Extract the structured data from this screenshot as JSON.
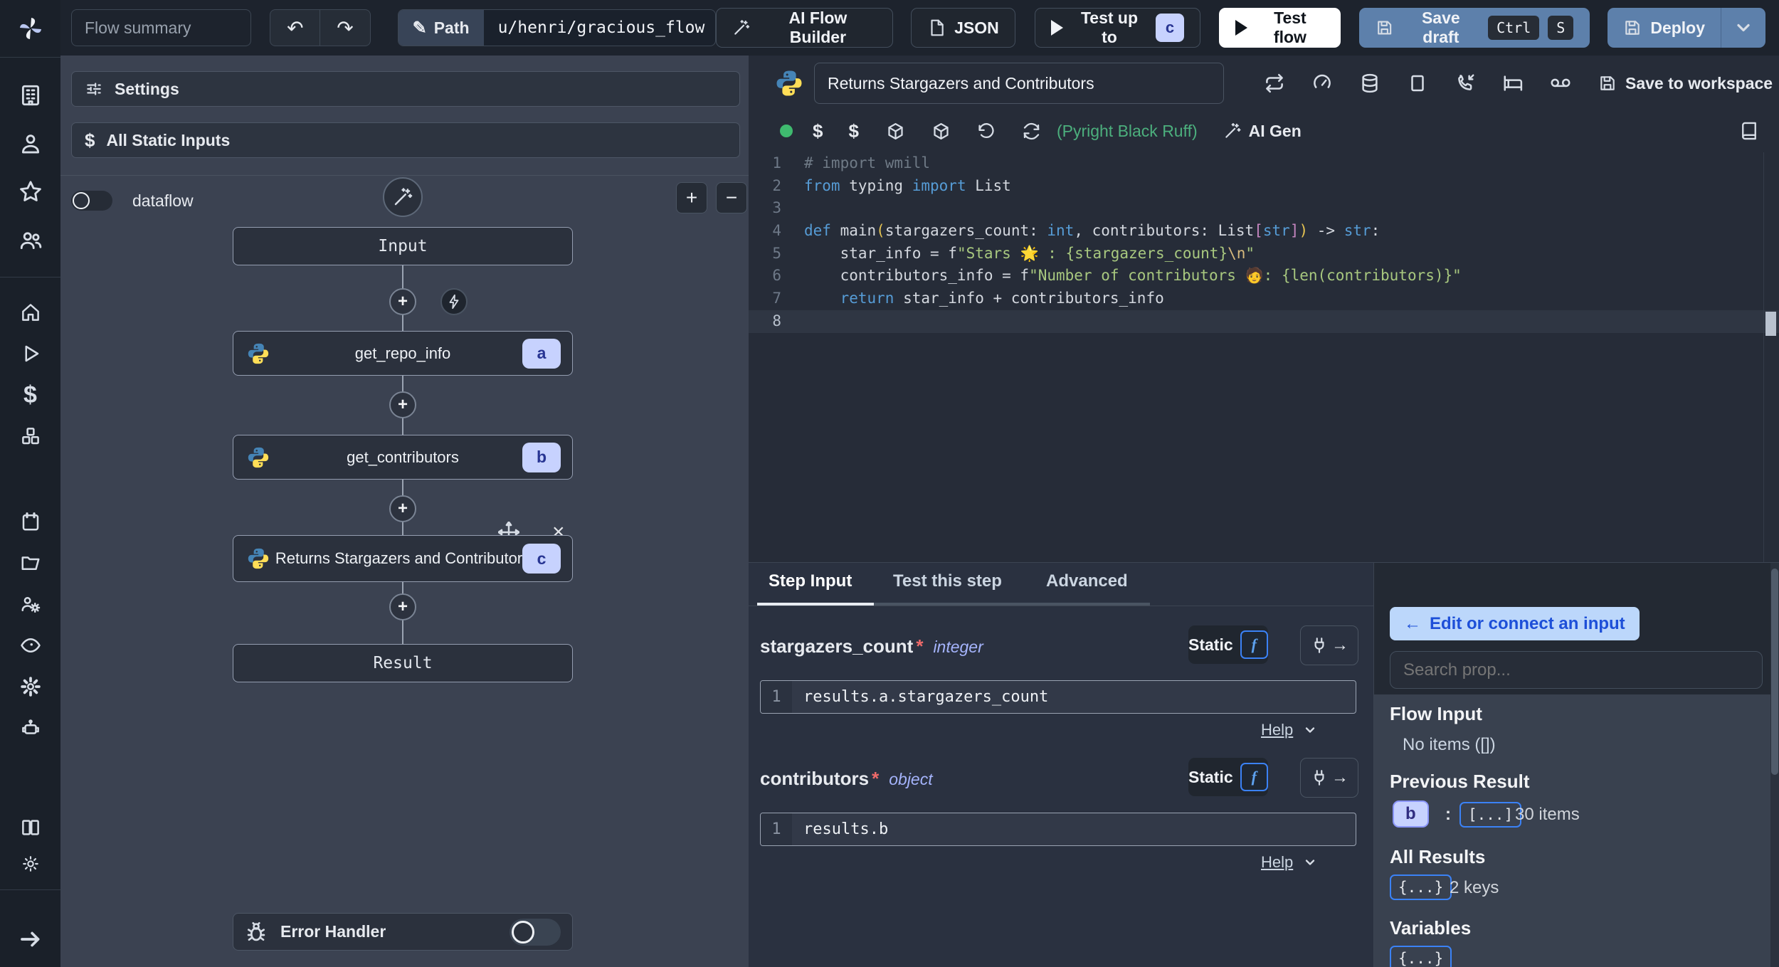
{
  "topbar": {
    "flow_summary": "Flow summary",
    "path_label": "Path",
    "path_value": "u/henri/gracious_flow",
    "ai_flow_builder": "AI Flow Builder",
    "json_label": "JSON",
    "test_up_to": "Test up to",
    "test_up_to_badge": "c",
    "test_flow": "Test flow",
    "save_draft": "Save draft",
    "kbd_ctrl": "Ctrl",
    "kbd_s": "S",
    "deploy": "Deploy"
  },
  "sidebar": {
    "icons": [
      "windmill-logo",
      "building",
      "user",
      "star",
      "users",
      "home",
      "play",
      "dollar",
      "cubes",
      "calendar",
      "folder",
      "users-gear",
      "eye",
      "gear",
      "robot",
      "books",
      "sun",
      "arrow-right"
    ]
  },
  "flow_panel": {
    "settings": "Settings",
    "all_static_inputs": "All Static Inputs",
    "dataflow": "dataflow",
    "zoom_in": "+",
    "zoom_out": "−",
    "input_node": "Input",
    "result_node": "Result",
    "steps": [
      {
        "id": "a",
        "title": "get_repo_info"
      },
      {
        "id": "b",
        "title": "get_contributors"
      },
      {
        "id": "c",
        "title": "Returns Stargazers and Contributors"
      }
    ],
    "error_handler": "Error Handler"
  },
  "editor": {
    "title_value": "Returns Stargazers and Contributors",
    "header_icons": [
      "repeat",
      "gauge",
      "database",
      "square",
      "phone-incoming",
      "bed",
      "voicemail"
    ],
    "save_to_workspace": "Save to workspace",
    "toolbar_icons": [
      "status-dot",
      "dollar",
      "dollar",
      "package",
      "package",
      "undo",
      "refresh",
      "book"
    ],
    "lint": "(Pyright Black Ruff)",
    "ai_gen": "AI Gen",
    "code_lines": [
      {
        "n": "1",
        "tokens": [
          [
            "# import wmill",
            "c"
          ]
        ]
      },
      {
        "n": "2",
        "tokens": [
          [
            "from",
            "k"
          ],
          [
            " typing ",
            "p"
          ],
          [
            "import",
            "k"
          ],
          [
            " List",
            "p"
          ]
        ]
      },
      {
        "n": "3",
        "tokens": []
      },
      {
        "n": "4",
        "tokens": [
          [
            "def ",
            "k"
          ],
          [
            "main",
            "p"
          ],
          [
            "(",
            "y"
          ],
          [
            "stargazers_count: ",
            "p"
          ],
          [
            "int",
            "t"
          ],
          [
            ", contributors: List",
            "p"
          ],
          [
            "[",
            "m"
          ],
          [
            "str",
            "t"
          ],
          [
            "]",
            "m"
          ],
          [
            ")",
            "y"
          ],
          [
            " -> ",
            "p"
          ],
          [
            "str",
            "t"
          ],
          [
            ":",
            "p"
          ]
        ]
      },
      {
        "n": "5",
        "tokens": [
          [
            "    star_info = f",
            "p"
          ],
          [
            "\"Stars 🌟 : {stargazers_count}",
            "s"
          ],
          [
            "\\n",
            "e"
          ],
          [
            "\"",
            "s"
          ]
        ]
      },
      {
        "n": "6",
        "tokens": [
          [
            "    contributors_info = f",
            "p"
          ],
          [
            "\"Number of contributors 🧑: {len(contributors)}\"",
            "s"
          ]
        ]
      },
      {
        "n": "7",
        "tokens": [
          [
            "    ",
            "p"
          ],
          [
            "return",
            "k"
          ],
          [
            " star_info + contributors_info",
            "p"
          ]
        ]
      },
      {
        "n": "8",
        "tokens": [],
        "active": true
      }
    ]
  },
  "step_panel": {
    "tabs": [
      {
        "label": "Step Input",
        "active": true
      },
      {
        "label": "Test this step",
        "active": false
      },
      {
        "label": "Advanced",
        "active": false
      }
    ],
    "fields": [
      {
        "name": "stargazers_count",
        "required": "*",
        "type": "integer",
        "mode": "Static",
        "fchip": "f",
        "line": "1",
        "expr": "results.a.stargazers_count",
        "help": "Help"
      },
      {
        "name": "contributors",
        "required": "*",
        "type": "object",
        "mode": "Static",
        "fchip": "f",
        "line": "1",
        "expr": "results.b",
        "help": "Help"
      }
    ]
  },
  "prop_panel": {
    "edit_connect_arrow": "←",
    "edit_connect": "Edit or connect an input",
    "search_placeholder": "Search prop...",
    "flow_input_title": "Flow Input",
    "flow_input_empty": "No items ([])",
    "previous_result_title": "Previous Result",
    "previous_result_badge": "b",
    "previous_result_colon": ":",
    "previous_result_chip": "[...]",
    "previous_result_count": "30 items",
    "all_results_title": "All Results",
    "all_results_chip": "{...}",
    "all_results_count": "2 keys",
    "variables_title": "Variables",
    "variables_chip": "{...}"
  },
  "colors": {
    "topbar_bg": "#1d232d",
    "sidebar_bg": "#1a2029",
    "flow_panel_bg": "#3b4251",
    "editor_bg": "#262c38",
    "accent_steel_blue": "#5d80ab",
    "badge_bg": "#c7d2fe",
    "badge_text": "#283593",
    "connect_btn_bg": "#bcd7fb",
    "connect_btn_text": "#1d4fd8",
    "lint_green": "#4caf7d",
    "status_green": "#3fba6f",
    "string_green": "#a8c87f",
    "keyword_blue": "#569cd6"
  }
}
